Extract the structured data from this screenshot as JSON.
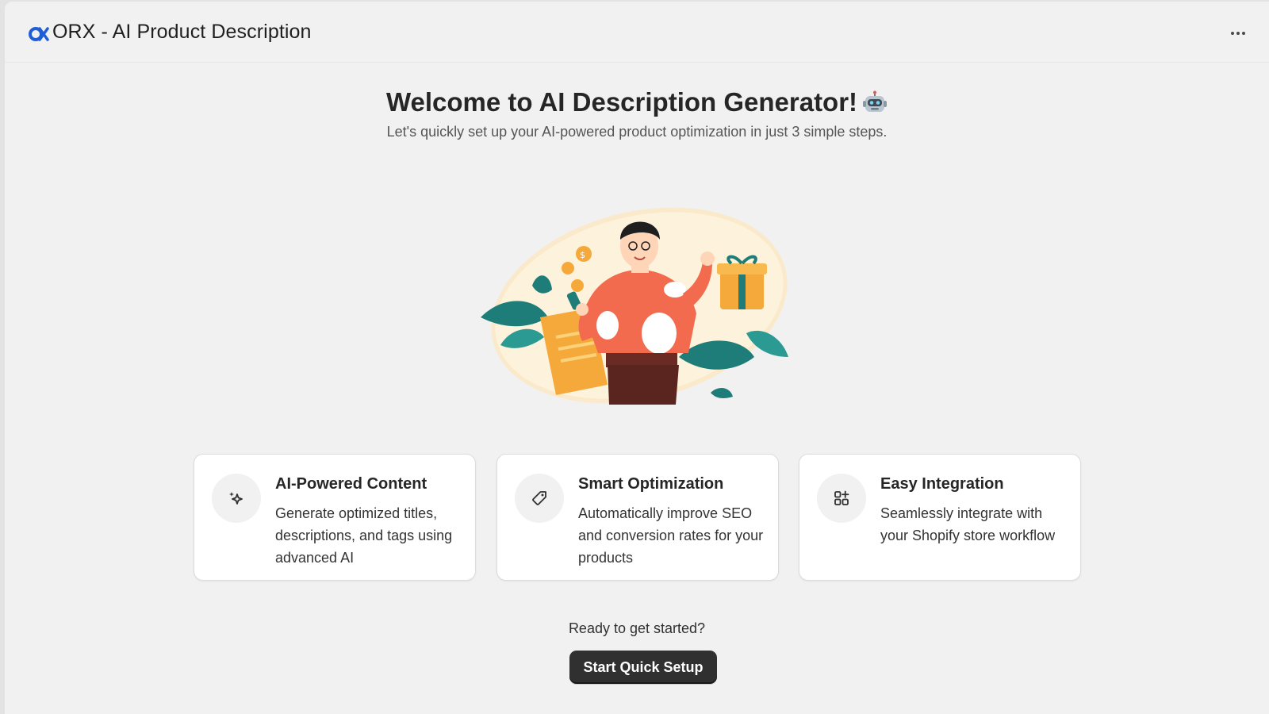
{
  "app": {
    "title": "ORX - AI Product Description",
    "logo_icon": "orx-logo-icon",
    "more_icon": "more-horizontal-icon"
  },
  "hero": {
    "title": "Welcome to AI Description Generator!",
    "emoji_icon": "robot-icon",
    "subtitle": "Let's quickly set up your AI-powered product optimization in just 3 simple steps."
  },
  "illustration": {
    "icon": "shopping-person-illustration"
  },
  "features": [
    {
      "icon": "sparkles-icon",
      "title": "AI-Powered Content",
      "text": "Generate optimized titles, descriptions, and tags using advanced AI"
    },
    {
      "icon": "tag-icon",
      "title": "Smart Optimization",
      "text": "Automatically improve SEO and conversion rates for your products"
    },
    {
      "icon": "apps-icon",
      "title": "Easy Integration",
      "text": "Seamlessly integrate with your Shopify store workflow"
    }
  ],
  "cta": {
    "prompt": "Ready to get started?",
    "button_label": "Start Quick Setup"
  },
  "colors": {
    "page_bg": "#f1f1f1",
    "card_bg": "#ffffff",
    "button_bg": "#303030",
    "logo_blue": "#1f5fd6",
    "illustration_orange": "#f26b4f",
    "illustration_teal": "#1e7d78"
  }
}
